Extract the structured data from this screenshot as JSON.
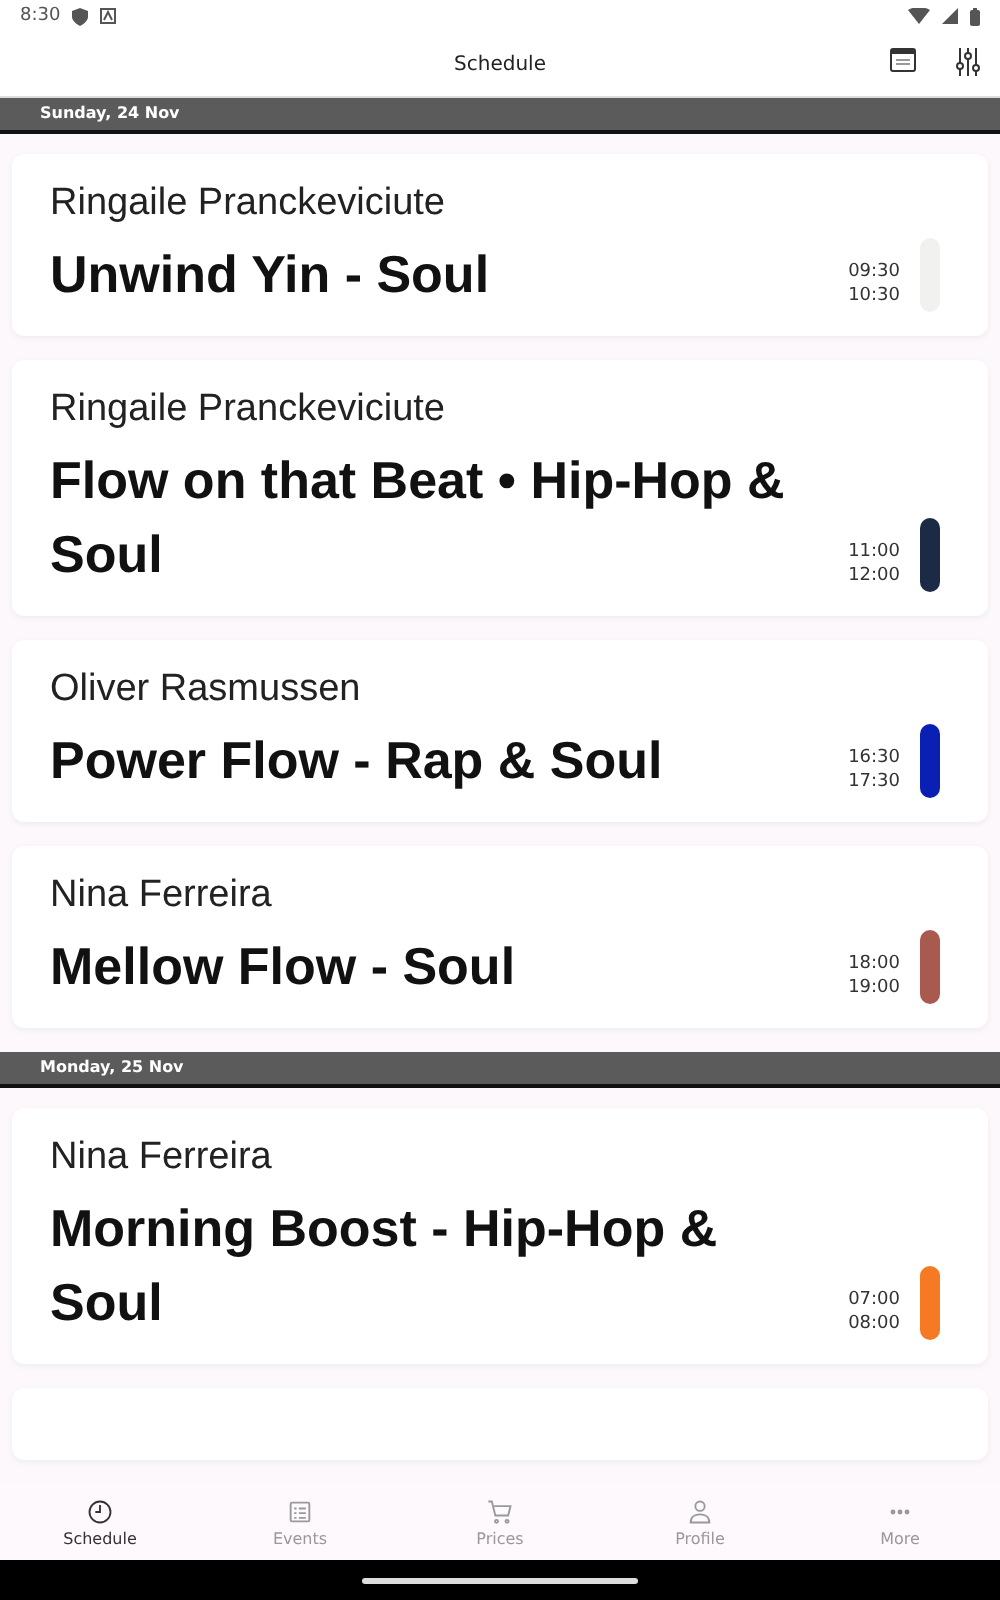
{
  "status_bar": {
    "time": "8:30"
  },
  "app_bar": {
    "title": "Schedule"
  },
  "days": [
    {
      "date": "Sunday, 24 Nov",
      "classes": [
        {
          "instructor": "Ringaile Pranckeviciute",
          "title": "Unwind Yin - Soul",
          "start": "09:30",
          "end": "10:30",
          "color": "#f1f1ef"
        },
        {
          "instructor": "Ringaile Pranckeviciute",
          "title": "Flow on that Beat • Hip-Hop & Soul",
          "start": "11:00",
          "end": "12:00",
          "color": "#1c2a45"
        },
        {
          "instructor": "Oliver Rasmussen",
          "title": "Power Flow - Rap & Soul",
          "start": "16:30",
          "end": "17:30",
          "color": "#0a1fb4"
        },
        {
          "instructor": "Nina Ferreira",
          "title": "Mellow Flow - Soul",
          "start": "18:00",
          "end": "19:00",
          "color": "#a85a4e"
        }
      ]
    },
    {
      "date": "Monday, 25 Nov",
      "classes": [
        {
          "instructor": "Nina Ferreira",
          "title": "Morning Boost - Hip-Hop & Soul",
          "start": "07:00",
          "end": "08:00",
          "color": "#f67a23"
        }
      ]
    }
  ],
  "nav": [
    {
      "label": "Schedule",
      "selected": true
    },
    {
      "label": "Events",
      "selected": false
    },
    {
      "label": "Prices",
      "selected": false
    },
    {
      "label": "Profile",
      "selected": false
    },
    {
      "label": "More",
      "selected": false
    }
  ]
}
